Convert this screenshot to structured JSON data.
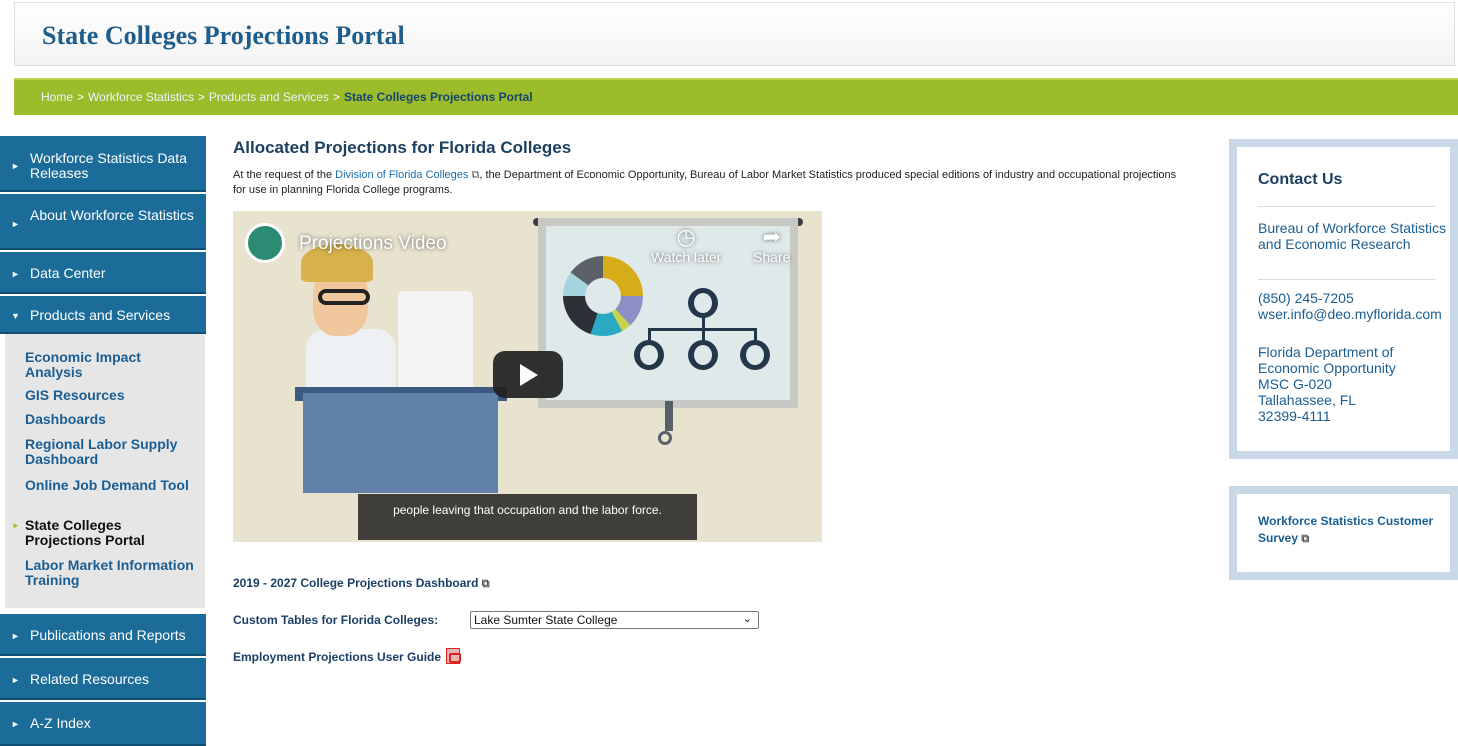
{
  "header": {
    "title": "State Colleges Projections Portal"
  },
  "breadcrumb": {
    "items": [
      "Home",
      "Workforce Statistics",
      "Products and Services"
    ],
    "separator": ">",
    "current": "State Colleges Projections Portal"
  },
  "sidebar": {
    "items": [
      {
        "label": "Workforce Statistics Data Releases"
      },
      {
        "label": "About Workforce Statistics"
      },
      {
        "label": "Data Center"
      },
      {
        "label": "Products and Services"
      },
      {
        "label": "Publications and Reports"
      },
      {
        "label": "Related Resources"
      },
      {
        "label": "A-Z Index"
      }
    ],
    "sub_items": [
      {
        "label": "Economic Impact Analysis"
      },
      {
        "label": "GIS Resources"
      },
      {
        "label": "Dashboards"
      },
      {
        "label": "Regional Labor Supply Dashboard"
      },
      {
        "label": "Online Job Demand Tool"
      },
      {
        "label": "State Colleges Projections Portal"
      },
      {
        "label": "Labor Market Information Training"
      }
    ]
  },
  "main": {
    "heading": "Allocated Projections for Florida Colleges",
    "intro_before": "At the request of the ",
    "intro_link": "Division of Florida Colleges",
    "intro_after": ", the Department of Economic Opportunity, Bureau of Labor Market Statistics produced special editions of industry and occupational projections for use in planning Florida College programs.",
    "video": {
      "title": "Projections Video",
      "watch_later": "Watch later",
      "share": "Share",
      "caption": "people leaving that occupation and the labor force."
    },
    "dashboard_link": "2019 - 2027 College Projections Dashboard",
    "custom_tables_label": "Custom Tables for Florida Colleges:",
    "custom_tables_value": "Lake Sumter State College",
    "user_guide_link": "Employment Projections User Guide"
  },
  "contact": {
    "heading": "Contact Us",
    "org": "Bureau of Workforce Statistics and Economic Research",
    "phone": "(850) 245-7205",
    "email": "wser.info@deo.myflorida.com",
    "address_line1": "Florida Department of Economic Opportunity",
    "address_line2": "MSC G-020",
    "address_line3": "Tallahassee, FL",
    "address_line4": "32399-4111"
  },
  "survey": {
    "label": "Workforce Statistics Customer Survey"
  },
  "colors": {
    "header_blue": "#1f5e8c",
    "nav_blue": "#1b6c99",
    "breadcrumb_green": "#9cbc2c"
  }
}
